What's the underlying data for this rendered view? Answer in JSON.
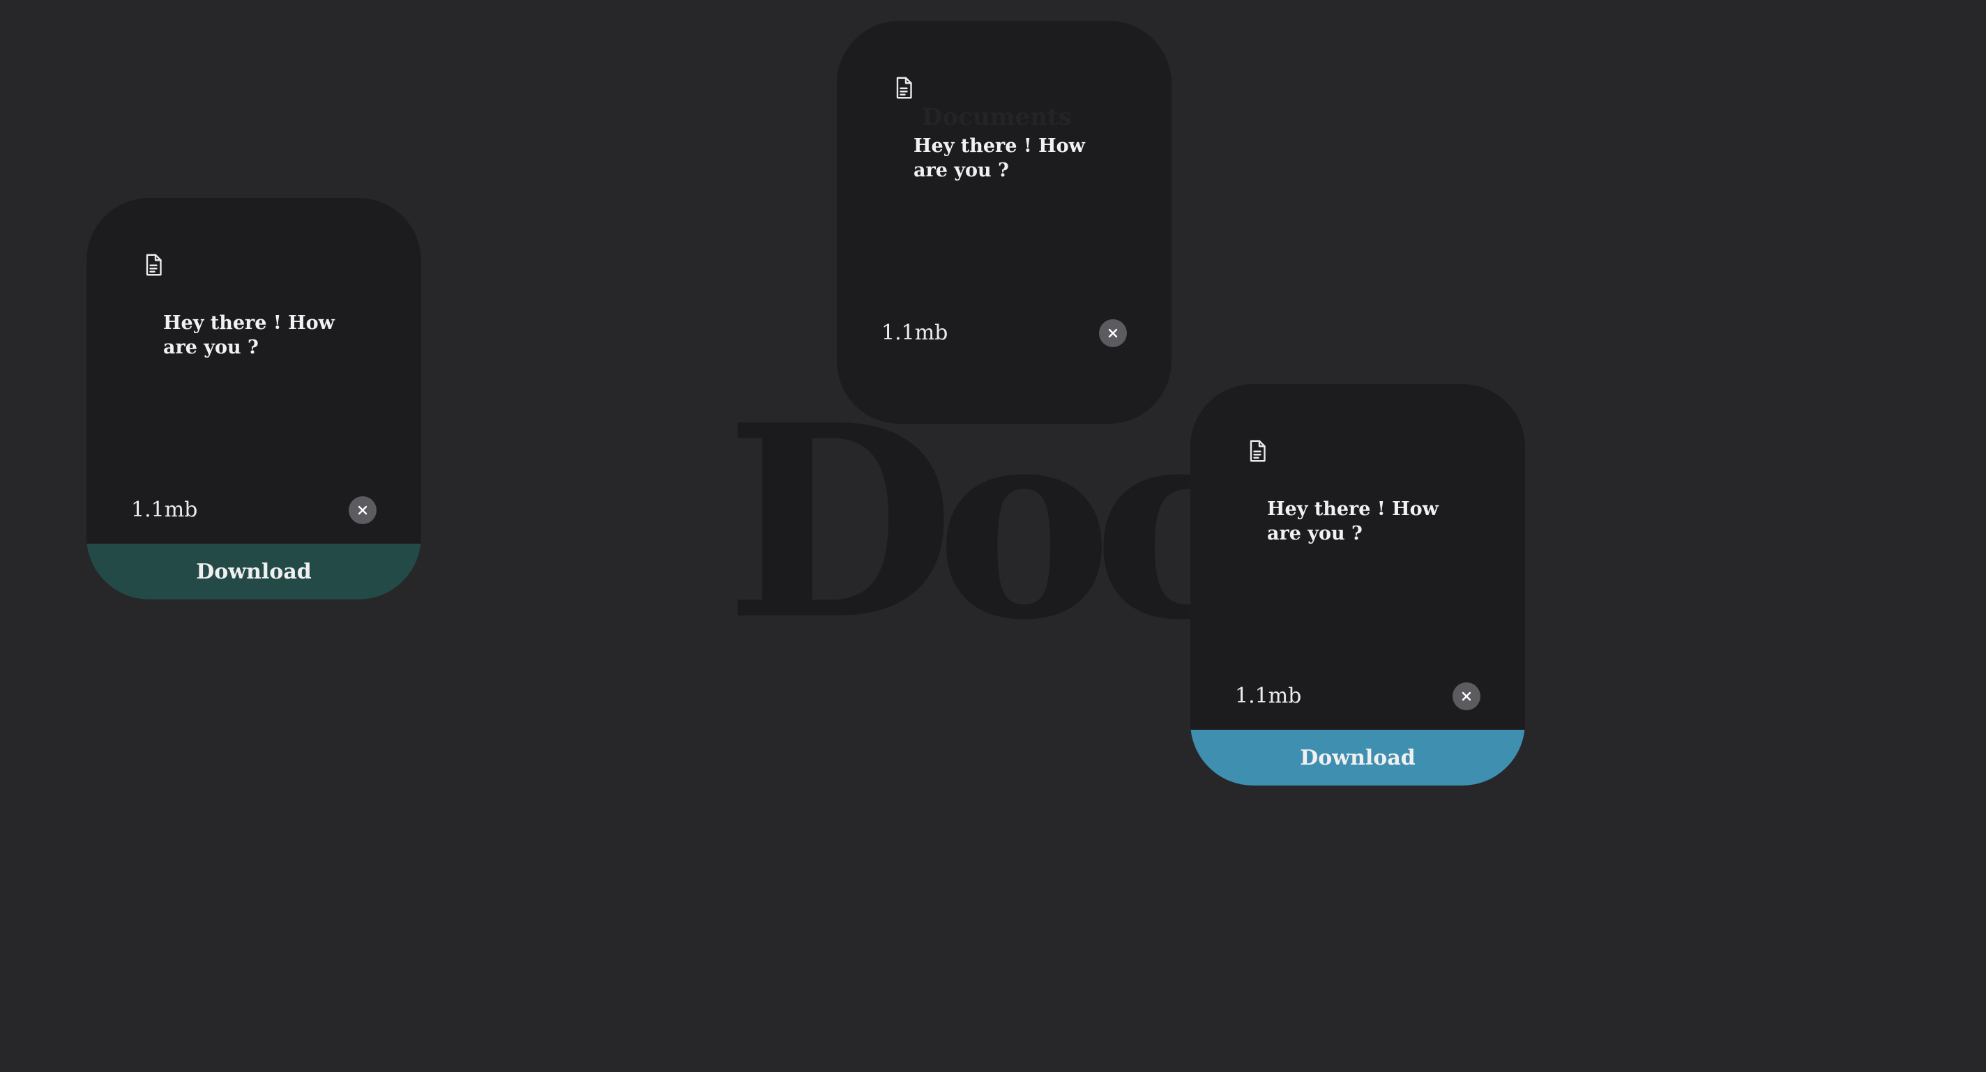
{
  "background": {
    "title": "Docs.",
    "color": "#27272a",
    "title_color": "#1b1b1d"
  },
  "cards": [
    {
      "message": "Hey there ! How are you ?",
      "size": "1.1mb",
      "icon": "document-icon",
      "close_icon": "close-icon",
      "download_label": "Download",
      "download_color": "#234a47"
    },
    {
      "heading": "Documents",
      "message": "Hey there ! How are you ?",
      "size": "1.1mb",
      "icon": "document-icon",
      "close_icon": "close-icon"
    },
    {
      "message": "Hey there ! How are you ?",
      "size": "1.1mb",
      "icon": "document-icon",
      "close_icon": "close-icon",
      "download_label": "Download",
      "download_color": "#3f8fb0"
    }
  ]
}
